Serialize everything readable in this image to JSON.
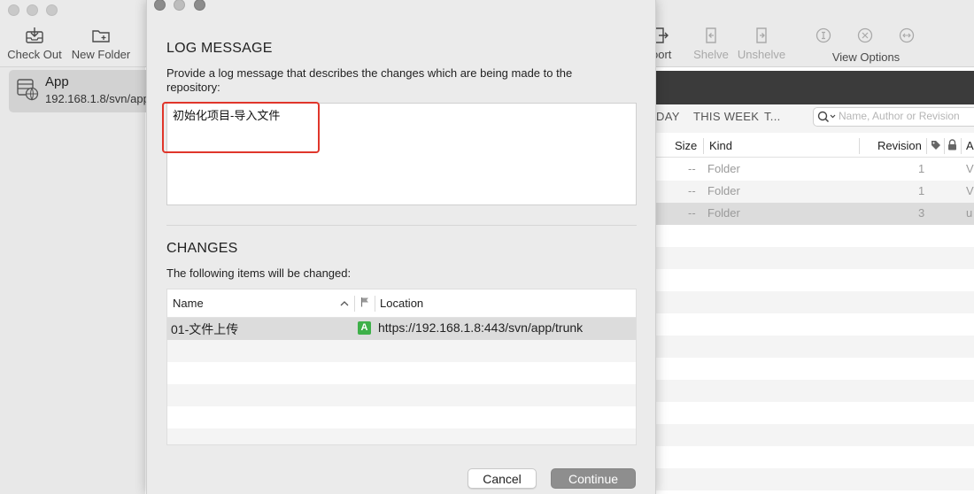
{
  "toolbar": {
    "checkout_label": "Check Out",
    "new_folder_label": "New Folder",
    "import_label": "oort",
    "shelve_label": "Shelve",
    "unshelve_label": "Unshelve",
    "view_options_label": "View Options"
  },
  "sidebar": {
    "repo_name": "App",
    "repo_url": "192.168.1.8/svn/app"
  },
  "filters": {
    "today": "DAY",
    "this_week": "THIS WEEK",
    "more": "T..."
  },
  "search": {
    "placeholder": "Name, Author or Revision"
  },
  "columns": {
    "size": "Size",
    "kind": "Kind",
    "revision": "Revision",
    "author_initial": "A"
  },
  "background_rows": [
    {
      "size": "--",
      "kind": "Folder",
      "revision": "1",
      "author": "V"
    },
    {
      "size": "--",
      "kind": "Folder",
      "revision": "1",
      "author": "V"
    },
    {
      "size": "--",
      "kind": "Folder",
      "revision": "3",
      "author": "u"
    }
  ],
  "dialog": {
    "log_title": "LOG MESSAGE",
    "log_desc": "Provide a log message that describes the changes which are being made to the repository:",
    "log_message": "初始化项目-导入文件",
    "changes_title": "CHANGES",
    "changes_desc": "The following items will be changed:",
    "col_name": "Name",
    "col_location": "Location",
    "change_rows": [
      {
        "name": "01-文件上传",
        "status": "A",
        "location": "https://192.168.1.8:443/svn/app/trunk"
      }
    ],
    "cancel_label": "Cancel",
    "continue_label": "Continue"
  },
  "colors": {
    "highlight": "#e0362b",
    "added_badge": "#3eb049",
    "continue_bg": "#8e8e8e"
  }
}
